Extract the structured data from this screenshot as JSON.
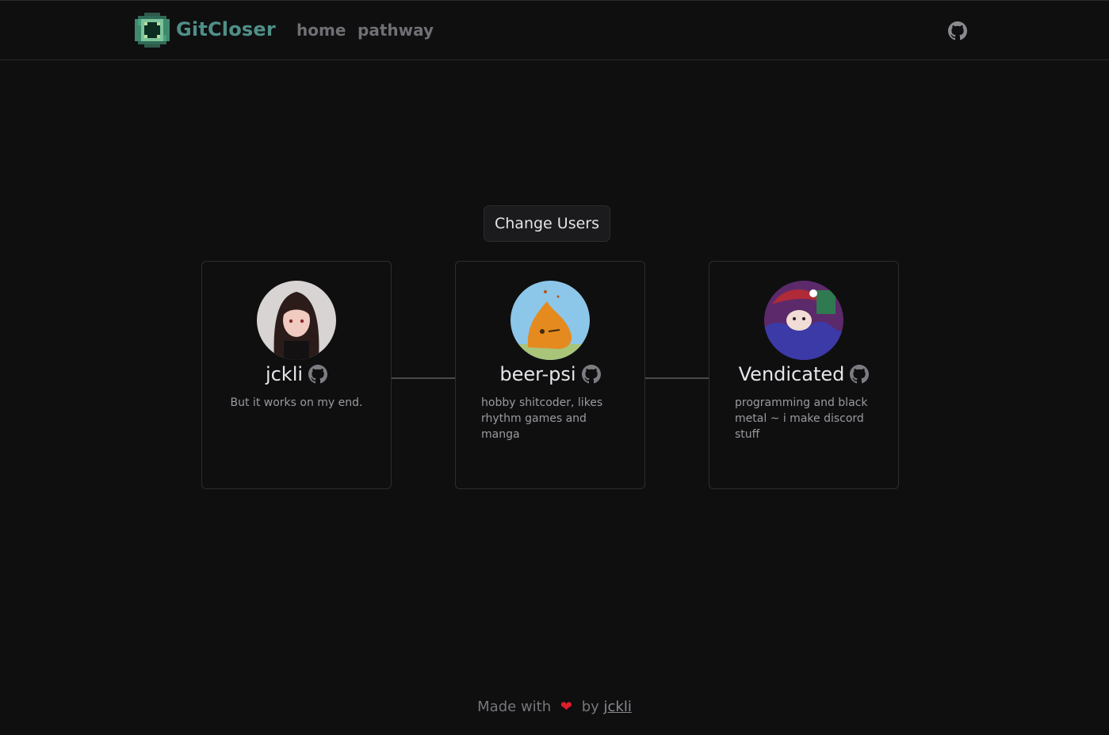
{
  "header": {
    "brand": "GitCloser",
    "nav": {
      "home": "home",
      "pathway": "pathway"
    },
    "logo_icon": "pixel-eye-icon",
    "github_icon": "github-icon"
  },
  "main": {
    "change_button": "Change Users",
    "users": [
      {
        "name": "jckli",
        "bio": "But it works on my end.",
        "avatar_colors": [
          "#d7d4d3",
          "#2b1c1a",
          "#f1cbc0"
        ]
      },
      {
        "name": "beer-psi",
        "bio": "hobby shitcoder, likes rhythm games and manga",
        "avatar_colors": [
          "#8cc6e8",
          "#e58a1f",
          "#a8c57a"
        ]
      },
      {
        "name": "Vendicated",
        "bio": "programming and black metal ~ i make discord stuff",
        "avatar_colors": [
          "#3b3aa7",
          "#b02a38",
          "#2f7a50"
        ]
      }
    ]
  },
  "footer": {
    "prefix": "Made with",
    "heart": "❤",
    "by": "by",
    "author": "jckli"
  },
  "colors": {
    "background": "#0f0f10",
    "brand": "#4f8f88",
    "border": "#2d2d31",
    "heart": "#e11d2a"
  }
}
